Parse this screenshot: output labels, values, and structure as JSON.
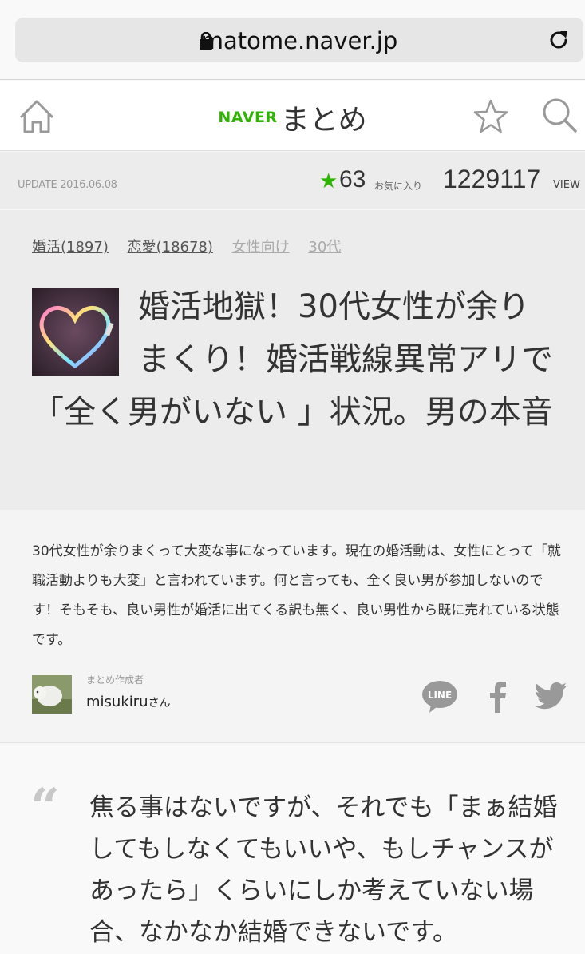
{
  "browser": {
    "url": "matome.naver.jp"
  },
  "header": {
    "logo_brand": "NAVER",
    "logo_title": "まとめ"
  },
  "meta": {
    "update": "UPDATE 2016.06.08",
    "favorites_count": "63",
    "favorites_label": "お気に入り",
    "view_count": "1229117",
    "view_label": "VIEW"
  },
  "tags": [
    {
      "label": "婚活(1897)"
    },
    {
      "label": "恋愛(18678)"
    },
    {
      "label": "女性向け"
    },
    {
      "label": "30代"
    }
  ],
  "article": {
    "title": "婚活地獄！30代女性が余りまくり！婚活戦線異常アリで「全く男がいない 」状況。男の本音",
    "description": "30代女性が余りまくって大変な事になっています。現在の婚活動は、女性にとって「就職活動よりも大変」と言われています。何と言っても、全く良い男が参加しないのです！そもそも、良い男性が婚活に出てくる訳も無く、良い男性から既に売れている状態です。"
  },
  "creator": {
    "label": "まとめ作成者",
    "name": "misukiru",
    "suffix": "さん"
  },
  "share": {
    "line_label": "LINE"
  },
  "quote": {
    "mark": "“",
    "text": "焦る事はないですが、それでも「まぁ結婚してもしなくてもいいや、もしチャンスがあったら」くらいにしか考えていない場合、なかなか結婚できないです。"
  },
  "colors": {
    "brand_green": "#2db400",
    "background": "#ececec"
  }
}
